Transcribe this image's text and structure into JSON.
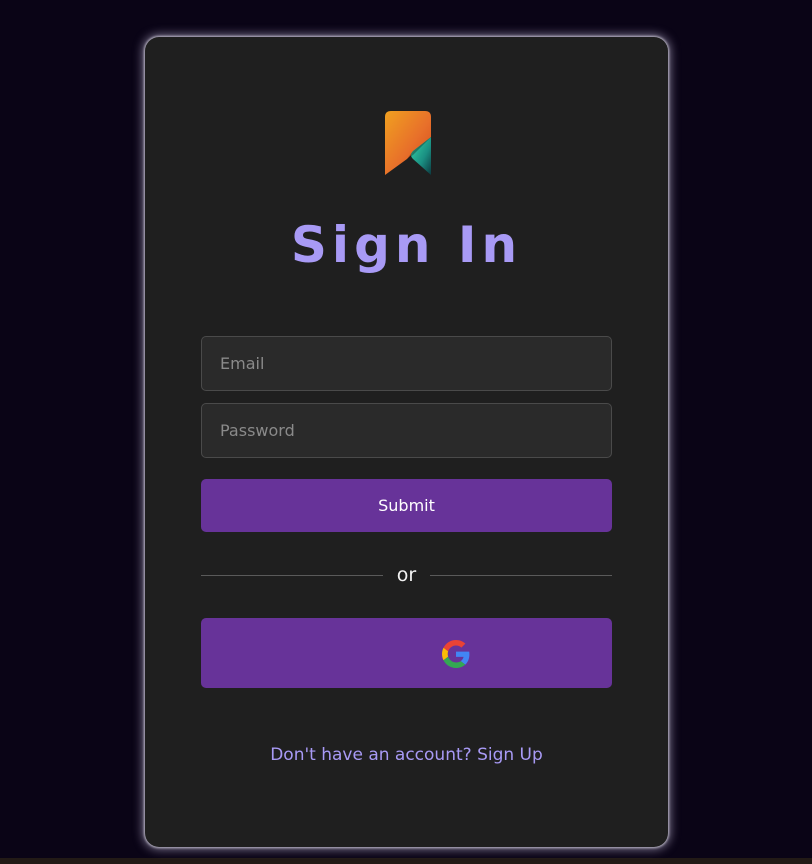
{
  "page": {
    "background_color": "#0a0416",
    "card_color": "#1f1f1f",
    "accent_color": "#673399",
    "title_color": "#a89af5"
  },
  "logo": {
    "icon": "bookmark-logo-icon"
  },
  "signin": {
    "title": "Sign In",
    "email_placeholder": "Email",
    "password_placeholder": "Password",
    "submit_label": "Submit",
    "divider_text": "or",
    "google_icon": "google-icon"
  },
  "footer": {
    "signup_text": "Don't have an account? Sign Up"
  }
}
